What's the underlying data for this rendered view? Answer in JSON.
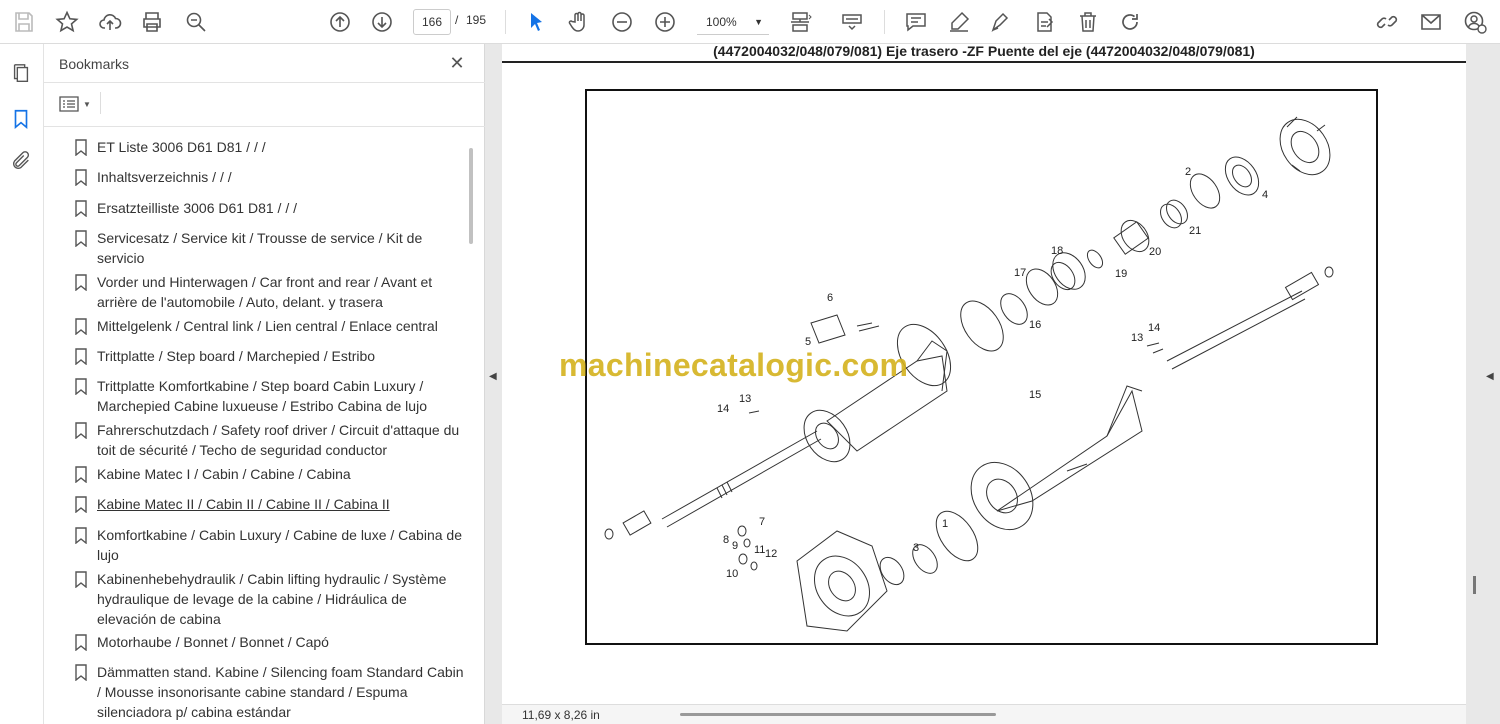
{
  "toolbar": {
    "current_page": "166",
    "page_separator": "/",
    "total_pages": "195",
    "zoom": "100%"
  },
  "bookmarks": {
    "title": "Bookmarks",
    "items": [
      {
        "label": "ET Liste 3006 D61 D81 /  /  /"
      },
      {
        "label": "Inhaltsverzeichnis /  /  /"
      },
      {
        "label": "Ersatzteilliste 3006 D61 D81 /  /  /"
      },
      {
        "label": "Servicesatz / Service kit / Trousse de service / Kit de servicio"
      },
      {
        "label": "Vorder und Hinterwagen / Car front and rear / Avant et arrière de l'automobile / Auto, delant. y trasera"
      },
      {
        "label": "Mittelgelenk / Central link / Lien central / Enlace central"
      },
      {
        "label": "Trittplatte / Step board / Marchepied / Estribo"
      },
      {
        "label": "Trittplatte Komfortkabine / Step board Cabin Luxury / Marchepied Cabine luxueuse / Estribo Cabina de lujo"
      },
      {
        "label": "Fahrerschutzdach / Safety roof driver / Circuit d'attaque du toit de sécurité / Techo de seguridad conductor"
      },
      {
        "label": "Kabine Matec I / Cabin / Cabine / Cabina"
      },
      {
        "label": "Kabine Matec II / Cabin II / Cabine II / Cabina II"
      },
      {
        "label": "Komfortkabine / Cabin Luxury / Cabine de luxe / Cabina de lujo"
      },
      {
        "label": "Kabinenhebehydraulik / Cabin lifting hydraulic / Système hydraulique de levage de la cabine / Hidráulica de elevación de cabina"
      },
      {
        "label": "Motorhaube / Bonnet / Bonnet / Capó"
      },
      {
        "label": "Dämmatten stand. Kabine / Silencing foam Standard Cabin / Mousse insonorisante cabine standard / Espuma silenciadora p/ cabina estándar"
      }
    ]
  },
  "document": {
    "heading": "(4472004032/048/079/081) Eje trasero -ZF Puente del eje (4472004032/048/079/081)",
    "watermark": "machinecatalogic.com",
    "page_size": "11,69 x 8,26 in",
    "callouts": [
      "1",
      "2",
      "3",
      "4",
      "5",
      "6",
      "7",
      "8",
      "9",
      "10",
      "11",
      "12",
      "13",
      "14",
      "15",
      "16",
      "17",
      "18",
      "19",
      "20",
      "21",
      "13",
      "14"
    ]
  },
  "colors": {
    "watermark": "#d4b21e",
    "toolbar_icon": "#555555",
    "active_tool": "#1473e6"
  }
}
